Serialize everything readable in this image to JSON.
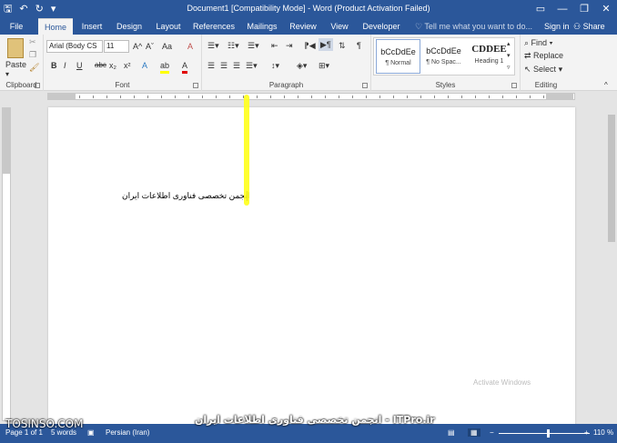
{
  "titlebar": {
    "title": "Document1 [Compatibility Mode] - Word (Product Activation Failed)",
    "save_icon": "save-icon",
    "undo_icon": "undo-icon",
    "redo_icon": "redo-icon"
  },
  "tabs": [
    "File",
    "Home",
    "Insert",
    "Design",
    "Layout",
    "References",
    "Mailings",
    "Review",
    "View",
    "Developer"
  ],
  "tell_me": "Tell me what you want to do...",
  "sign_in": "Sign in",
  "share": "Share",
  "clipboard": {
    "paste": "Paste",
    "label": "Clipboard"
  },
  "font": {
    "name": "Arial (Body CS",
    "size": "11",
    "label": "Font",
    "bold": "B",
    "italic": "I",
    "underline": "U",
    "strike": "abc",
    "sub": "x₂",
    "sup": "x²",
    "grow": "A^",
    "shrink": "Aˇ",
    "case": "Aa",
    "clear": "A",
    "effects": "A",
    "highlight": "ab",
    "color": "A"
  },
  "paragraph": {
    "label": "Paragraph"
  },
  "styles": {
    "label": "Styles",
    "items": [
      {
        "preview": "bCcDdEe",
        "name": "¶ Normal"
      },
      {
        "preview": "bCcDdEe",
        "name": "¶ No Spac..."
      },
      {
        "preview": "CDDEE",
        "name": "Heading 1"
      }
    ]
  },
  "editing": {
    "label": "Editing",
    "find": "Find",
    "replace": "Replace",
    "select": "Select"
  },
  "document": {
    "text": "انجمن تخصصی فناوری اطلاعات ایران",
    "activation": "Activate Windows"
  },
  "status": {
    "page": "Page 1 of 1",
    "words": "5 words",
    "language": "Persian (Iran)",
    "zoom": "110 %"
  },
  "watermark": {
    "left": "TOSINSO.COM",
    "center": "انجمن تخصصی فناوری اطلاعات ایران - ITPro.ir"
  }
}
